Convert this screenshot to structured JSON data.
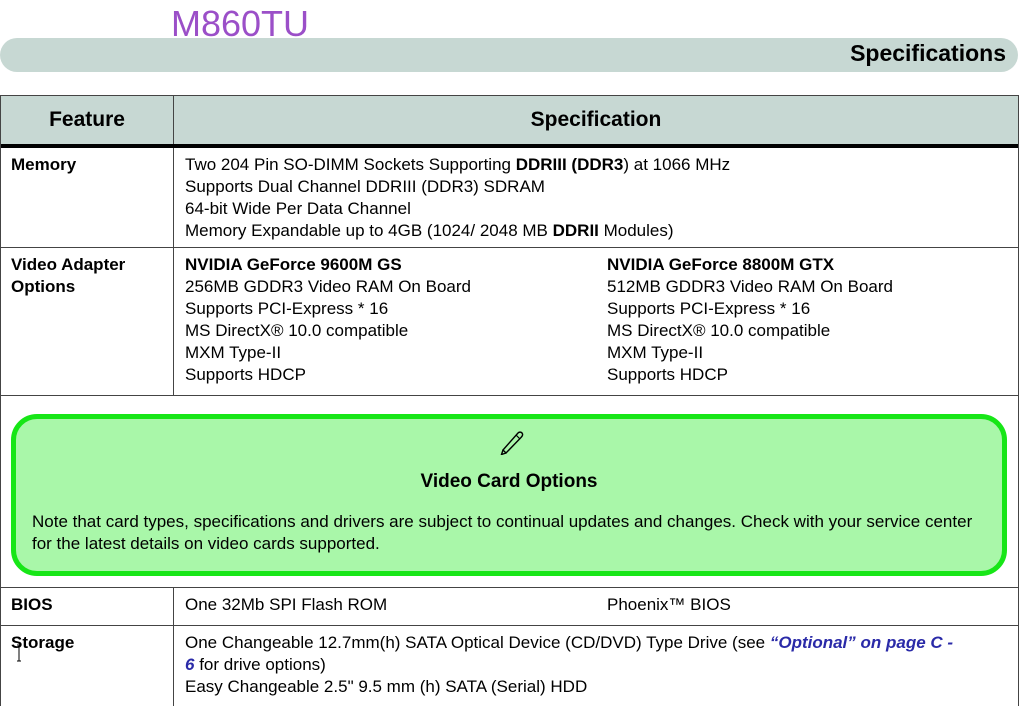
{
  "header": {
    "model": "M860TU",
    "section_title": "Specifications"
  },
  "table": {
    "headers": {
      "feature": "Feature",
      "specification": "Specification"
    },
    "memory": {
      "feature": "Memory",
      "line1_pre": "Two 204 Pin SO-DIMM Sockets Supporting ",
      "line1_bold": "DDRIII (DDR3",
      "line1_post": ") at 1066 MHz",
      "line2": "Supports Dual Channel DDRIII (DDR3) SDRAM",
      "line3": "64-bit Wide Per Data Channel",
      "line4_pre": "Memory Expandable up to 4GB (1024/ 2048 MB ",
      "line4_bold": "DDRII",
      "line4_post": " Modules)"
    },
    "video": {
      "feature_line1": "Video Adapter",
      "feature_line2": "Options",
      "col_a": {
        "title": "NVIDIA GeForce 9600M GS",
        "lines": [
          "256MB GDDR3 Video RAM On Board",
          "Supports PCI-Express * 16",
          "MS DirectX® 10.0 compatible",
          "MXM Type-II",
          "Supports HDCP"
        ]
      },
      "col_b": {
        "title": "NVIDIA GeForce 8800M GTX",
        "lines": [
          "512MB GDDR3 Video RAM On Board",
          "Supports PCI-Express * 16",
          "MS DirectX® 10.0 compatible",
          "MXM Type-II",
          "Supports HDCP"
        ]
      }
    },
    "note": {
      "icon": "pen-icon",
      "title": "Video Card Options",
      "text": "Note that card types, specifications and drivers are subject to continual updates and changes. Check with your service center for the latest details on video cards supported."
    },
    "bios": {
      "feature": "BIOS",
      "col_a": "One 32Mb SPI Flash ROM",
      "col_b": "Phoenix™ BIOS"
    },
    "storage": {
      "feature": "Storage",
      "line1_pre": "One Changeable 12.7mm(h) SATA Optical Device (CD/DVD) Type Drive (see ",
      "line1_link": "“Optional” on page C -",
      "line2_link": "6",
      "line2_post": " for drive options)",
      "line3": "Easy Changeable 2.5\" 9.5 mm (h) SATA (Serial) HDD"
    }
  },
  "colors": {
    "model": "#9b4fc8",
    "header_bar": "#c7d8d3",
    "note_fill": "#a9f7a9",
    "note_border": "#17e617",
    "link": "#2a2aa8"
  }
}
